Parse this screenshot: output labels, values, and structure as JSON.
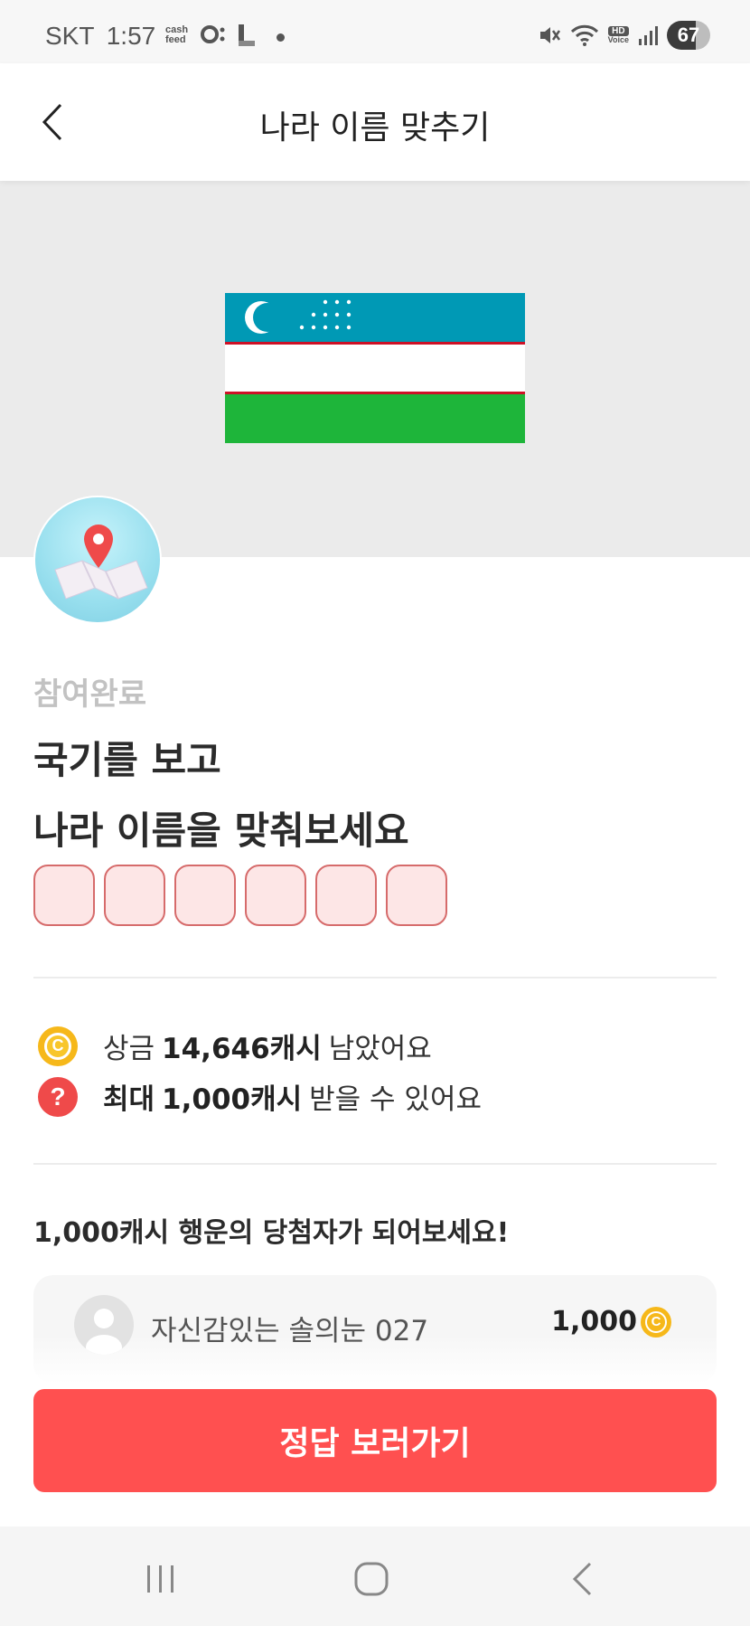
{
  "status_bar": {
    "carrier": "SKT",
    "time": "1:57",
    "cashfeed_line1": "cash",
    "cashfeed_line2": "feed",
    "hd_line1": "HD",
    "hd_line2": "Voice",
    "battery": "67"
  },
  "header": {
    "title": "나라 이름 맞추기",
    "back_icon": "chevron-left-icon"
  },
  "quiz": {
    "flag_colors": {
      "blue": "#0099b5",
      "white": "#ffffff",
      "red": "#ce1126",
      "green": "#1eb53a"
    },
    "status": "참여완료",
    "question_line1": "국기를 보고",
    "question_line2": "나라 이름을 맞춰보세요",
    "answer_box_count": 6
  },
  "info": {
    "prize_prefix": "상금",
    "prize_amount": "14,646캐시",
    "prize_suffix": "남았어요",
    "max_prefix": "최대",
    "max_amount": "1,000캐시",
    "max_suffix": "받을 수 있어요",
    "coin_symbol": "C",
    "help_symbol": "?"
  },
  "winners": {
    "title": "1,000캐시 행운의 당첨자가 되어보세요!",
    "entries": [
      {
        "name": "자신감있는 솔의눈 027",
        "amount": "1,000"
      }
    ]
  },
  "cta": {
    "label": "정답 보러가기"
  },
  "colors": {
    "accent": "#ff5050",
    "coin": "#f6b81a"
  }
}
